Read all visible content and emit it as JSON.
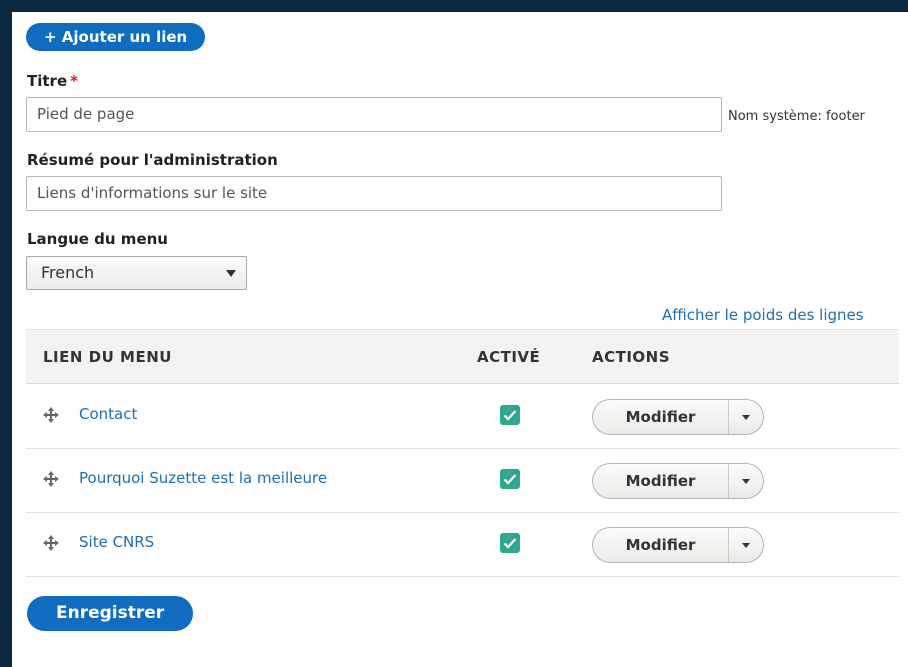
{
  "add_link": "+ Ajouter un lien",
  "title_field": {
    "label": "Titre",
    "required_mark": "*",
    "value": "Pied de page",
    "system_name": "Nom système: footer"
  },
  "summary_field": {
    "label": "Résumé pour l'administration",
    "value": "Liens d'informations sur le site"
  },
  "language": {
    "label": "Langue du menu",
    "selected": "French"
  },
  "show_weights_link": "Afficher le poids des lignes",
  "table": {
    "headers": {
      "link": "LIEN DU MENU",
      "enabled": "ACTIVÉ",
      "actions": "ACTIONS"
    },
    "rows": [
      {
        "label": "Contact",
        "enabled": true,
        "action": "Modifier"
      },
      {
        "label": "Pourquoi Suzette est la meilleure",
        "enabled": true,
        "action": "Modifier"
      },
      {
        "label": "Site CNRS",
        "enabled": true,
        "action": "Modifier"
      }
    ]
  },
  "save_button": "Enregistrer",
  "colors": {
    "primary": "#0f6cbf",
    "link": "#1f6fa8",
    "check": "#2fa68f",
    "required": "#e01e1e",
    "frame": "#0b2940"
  },
  "icons": {
    "drag": "drag-handle-icon",
    "check": "checkbox-checked-icon",
    "caret": "chevron-down-icon"
  }
}
